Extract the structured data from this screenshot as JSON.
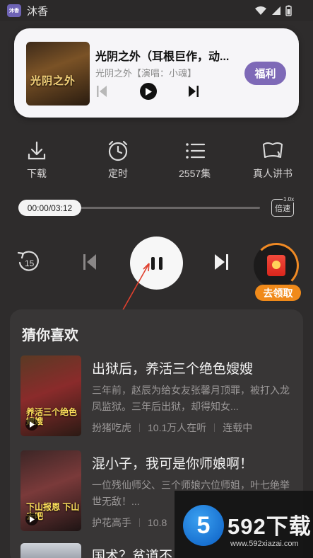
{
  "status_bar": {
    "app_badge": "沐香",
    "app_name": "沐香"
  },
  "notification": {
    "title": "光阴之外（耳根巨作，动...",
    "subtitle": "光阴之外【演唱：小魂】",
    "cover_text": "光阴之外",
    "welfare_label": "福利"
  },
  "actions": [
    {
      "label": "下载",
      "icon": "download-icon"
    },
    {
      "label": "定时",
      "icon": "timer-icon"
    },
    {
      "label": "2557集",
      "icon": "episode-list-icon"
    },
    {
      "label": "真人讲书",
      "icon": "human-narration-icon"
    }
  ],
  "player": {
    "time": "00:00/03:12",
    "progress": 0,
    "speed_value": "1.0x",
    "speed_label": "倍速",
    "rewind_seconds": "15",
    "state": "playing",
    "claim_label": "去领取"
  },
  "recommendations": {
    "heading": "猜你喜欢",
    "items": [
      {
        "title": "出狱后，养活三个绝色嫂嫂",
        "description": "三年前，赵辰为给女友张馨月顶罪，被打入龙凤监狱。三年后出狱，却得知女...",
        "author": "扮猪吃虎",
        "listeners": "10.1万人在听",
        "status": "连载中",
        "cover_tag": "养活三个绝色嫂嫂"
      },
      {
        "title": "混小子，我可是你师娘啊！",
        "description": "一位残仙师父、三个师娘六位师姐，叶七绝举世无敌！...",
        "author": "护花高手",
        "listeners": "10.8",
        "status": "",
        "cover_tag": "下山报恩 下山去吧"
      },
      {
        "title": "国术？贫道不",
        "description": "",
        "author": "",
        "listeners": "",
        "status": ""
      }
    ],
    "more_label": "···"
  },
  "watermark": {
    "brand": "592下载",
    "url": "www.592xiazai.com",
    "logo_char": "5"
  },
  "colors": {
    "accent_purple": "#7e69b7",
    "accent_orange": "#f08a1a",
    "background": "#2e2c2c"
  }
}
